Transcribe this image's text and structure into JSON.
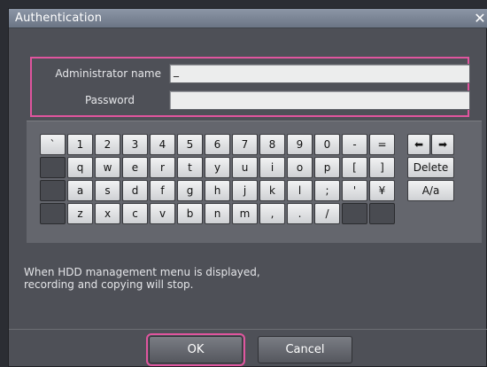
{
  "window": {
    "title": "Authentication",
    "close_glyph": "✕"
  },
  "credentials": {
    "admin_label": "Administrator name",
    "admin_value": "_",
    "password_label": "Password",
    "password_value": ""
  },
  "keyboard": {
    "row1": [
      "`",
      "1",
      "2",
      "3",
      "4",
      "5",
      "6",
      "7",
      "8",
      "9",
      "0",
      "-",
      "="
    ],
    "row2": [
      "",
      "q",
      "w",
      "e",
      "r",
      "t",
      "y",
      "u",
      "i",
      "o",
      "p",
      "[",
      "]"
    ],
    "row3": [
      "",
      "a",
      "s",
      "d",
      "f",
      "g",
      "h",
      "j",
      "k",
      "l",
      ";",
      "'",
      "¥"
    ],
    "row4": [
      "",
      "z",
      "x",
      "c",
      "v",
      "b",
      "n",
      "m",
      ",",
      ".",
      "/",
      "",
      ""
    ],
    "arrow_left": "⬅",
    "arrow_right": "➡",
    "delete_label": "Delete",
    "case_label": "A/a"
  },
  "message": {
    "line1": "When HDD management menu is displayed,",
    "line2": "recording and copying will stop."
  },
  "buttons": {
    "ok_label": "OK",
    "cancel_label": "Cancel"
  },
  "colors": {
    "highlight": "#e0559e",
    "titlebar": "#8c96a6"
  }
}
